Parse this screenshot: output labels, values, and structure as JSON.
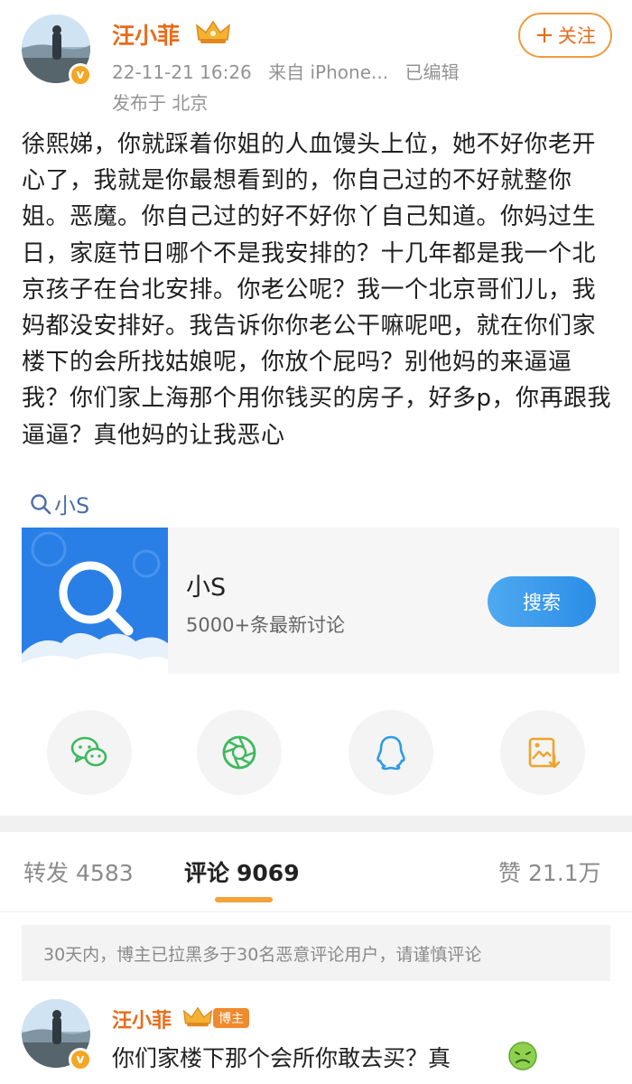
{
  "post": {
    "author": "汪小菲",
    "verified_mark": "v",
    "timestamp": "22-11-21 16:26",
    "source": "来自 iPhone...",
    "edited": "已编辑",
    "location": "发布于 北京",
    "follow_label": "关注",
    "body": "徐熙娣，你就踩着你姐的人血馒头上位，她不好你老开心了，我就是你最想看到的，你自己过的不好就整你姐。恶魔。你自己过的好不好你丫自己知道。你妈过生日，家庭节日哪个不是我安排的？十几年都是我一个北京孩子在台北安排。你老公呢？我一个北京哥们儿，我妈都没安排好。我告诉你你老公干嘛呢吧，就在你们家楼下的会所找姑娘呢，你放个屁吗？别他妈的来逼逼我？你们家上海那个用你钱买的房子，好多p，你再跟我逼逼？真他妈的让我恶心",
    "topic": "小S"
  },
  "search_card": {
    "title": "小S",
    "subtitle": "5000+条最新讨论",
    "button": "搜索"
  },
  "share": {
    "icons": [
      "wechat-icon",
      "moments-icon",
      "qq-icon",
      "save-image-icon"
    ]
  },
  "stats": {
    "repost_label": "转发",
    "repost_count": "4583",
    "comment_label": "评论",
    "comment_count": "9069",
    "like_label": "赞",
    "like_count": "21.1万"
  },
  "notice": "30天内，博主已拉黑多于30名恶意评论用户，请谨慎评论",
  "comment": {
    "author": "汪小菲",
    "tag": "博主",
    "text": "你们家楼下那个会所你敢去买？真"
  },
  "colors": {
    "accent": "#e86b1a",
    "link": "#4a6ea8",
    "tab_underline": "#f3a23a",
    "search_button": "#2b8de8"
  }
}
